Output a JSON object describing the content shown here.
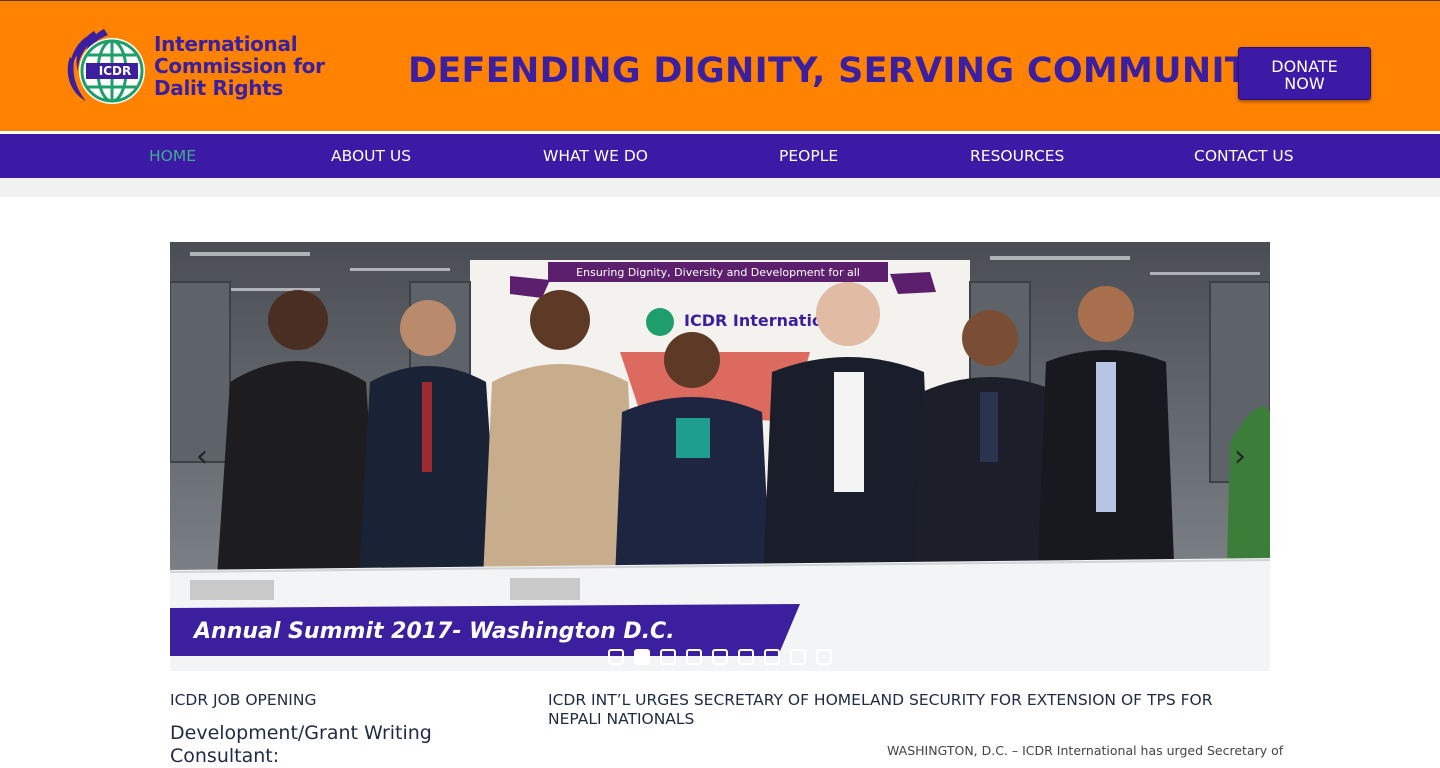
{
  "header": {
    "logo": {
      "badge_text": "ICDR",
      "name_lines": [
        "International",
        "Commission for",
        "Dalit Rights"
      ]
    },
    "slogan": "DEFENDING DIGNITY, SERVING COMMUNITY!",
    "donate": {
      "line1": "DONATE",
      "line2": "NOW"
    },
    "colors": {
      "header_bg": "#ff8300",
      "brand_purple": "#3d1aa6",
      "nav_active": "#3fae8a"
    }
  },
  "nav": {
    "items": [
      {
        "label": "HOME",
        "active": true
      },
      {
        "label": "ABOUT US",
        "active": false
      },
      {
        "label": "WHAT WE DO",
        "active": false
      },
      {
        "label": "PEOPLE",
        "active": false
      },
      {
        "label": "RESOURCES",
        "active": false
      },
      {
        "label": "CONTACT US",
        "active": false
      }
    ]
  },
  "slider": {
    "banner_top": "Ensuring Dignity, Diversity and Development for all",
    "sign_text": "ICDR International",
    "caption": "Annual Summit 2017- Washington D.C.",
    "prev_icon": "chevron-left-icon",
    "next_icon": "chevron-right-icon",
    "slide_count": 9,
    "active_index": 1
  },
  "main": {
    "job": {
      "title": "ICDR JOB OPENING",
      "subtitle": "Development/Grant Writing Consultant:"
    },
    "news": {
      "title": "ICDR INT’L URGES SECRETARY OF HOMELAND SECURITY FOR EXTENSION OF TPS FOR NEPALI NATIONALS",
      "body": "WASHINGTON, D.C. – ICDR International has urged Secretary of"
    }
  }
}
